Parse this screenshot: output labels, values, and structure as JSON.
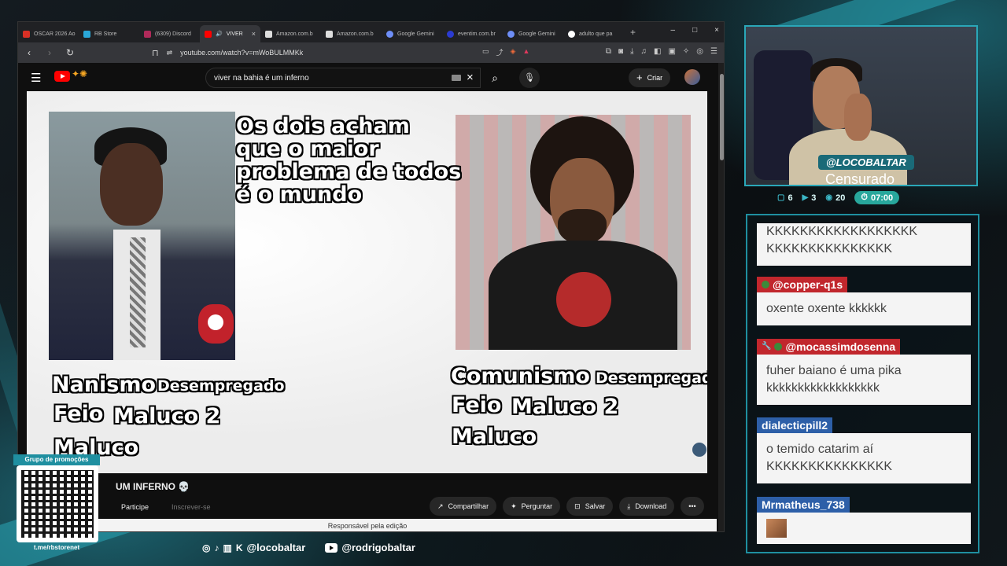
{
  "browser": {
    "tabs": [
      {
        "label": "OSCAR 2026 Ao",
        "color": "#d93025"
      },
      {
        "label": "RB Store",
        "color": "#2aa7d8"
      },
      {
        "label": "(6309) Discord",
        "color": "#b02a5a"
      },
      {
        "label": "VIVER",
        "color": "#ff0000",
        "active": true
      },
      {
        "label": "Amazon.com.b",
        "color": "#ddd"
      },
      {
        "label": "Amazon.com.b",
        "color": "#ddd"
      },
      {
        "label": "Google Gemini",
        "color": "#6e8ef7"
      },
      {
        "label": "eventim.com.br",
        "color": "#2b3bd1"
      },
      {
        "label": "Google Gemini",
        "color": "#6e8ef7"
      },
      {
        "label": "adulto que pa",
        "color": "#ffffff"
      }
    ],
    "tab_close": "×",
    "new_tab": "+",
    "window_controls": [
      "–",
      "□",
      "×"
    ],
    "url": "youtube.com/watch?v=mWoBULMMKk"
  },
  "youtube": {
    "search_value": "viver na bahia é um inferno",
    "create_label": "Criar",
    "video_title": "UM INFERNO 💀",
    "join_label": "Participe",
    "subscribe_label": "Inscrever-se",
    "actions": [
      {
        "icon": "↗",
        "label": "Compartilhar"
      },
      {
        "icon": "✦",
        "label": "Perguntar"
      },
      {
        "icon": "⊡",
        "label": "Salvar"
      },
      {
        "icon": "⤓",
        "label": "Download"
      }
    ],
    "more_icon": "•••",
    "footer_text": "Responsável pela edição"
  },
  "video_frame": {
    "caption_lines": [
      "Os dois acham",
      "que o maior",
      "problema de todos",
      "é o mundo"
    ],
    "left_labels": {
      "l1": "Nanismo",
      "l1b": "Desempregado",
      "l2": "Feio",
      "l2b": "Maluco 2",
      "l3": "Maluco"
    },
    "right_labels": {
      "r1": "Comunismo",
      "r1b": "Desempregado",
      "r2": "Feio",
      "r2b": "Maluco 2",
      "r3": "Maluco"
    }
  },
  "overlay": {
    "qr_title": "Grupo de promoções",
    "qr_link": "t.me/rbstorenet",
    "socials_handle_1": "@locobaltar",
    "socials_handle_2": "@rodrigobaltar"
  },
  "webcam": {
    "name": "@LOCOBALTAR",
    "status": "Censurado",
    "stats": {
      "chat": "6",
      "youtube": "3",
      "viewers": "20",
      "timer": "07:00"
    }
  },
  "chat": {
    "messages": [
      {
        "user": "",
        "text": "KKKKKKKKKKKKKKKKKK KKKKKKKKKKKKKKK"
      },
      {
        "user": "@copper-q1s",
        "badge_color": "#c1272d",
        "text": "oxente oxente kkkkkk"
      },
      {
        "user": "@mocassimdosenna",
        "badge_color": "#c1272d",
        "text": "fuher baiano é uma pika kkkkkkkkkkkkkkkkkk"
      },
      {
        "user": "dialecticpill2",
        "badge_color": "#2d5fa8",
        "text": "o temido catarim aí KKKKKKKKKKKKKKK"
      },
      {
        "user": "Mrmatheus_738",
        "badge_color": "#2d5fa8",
        "text": ""
      }
    ]
  }
}
